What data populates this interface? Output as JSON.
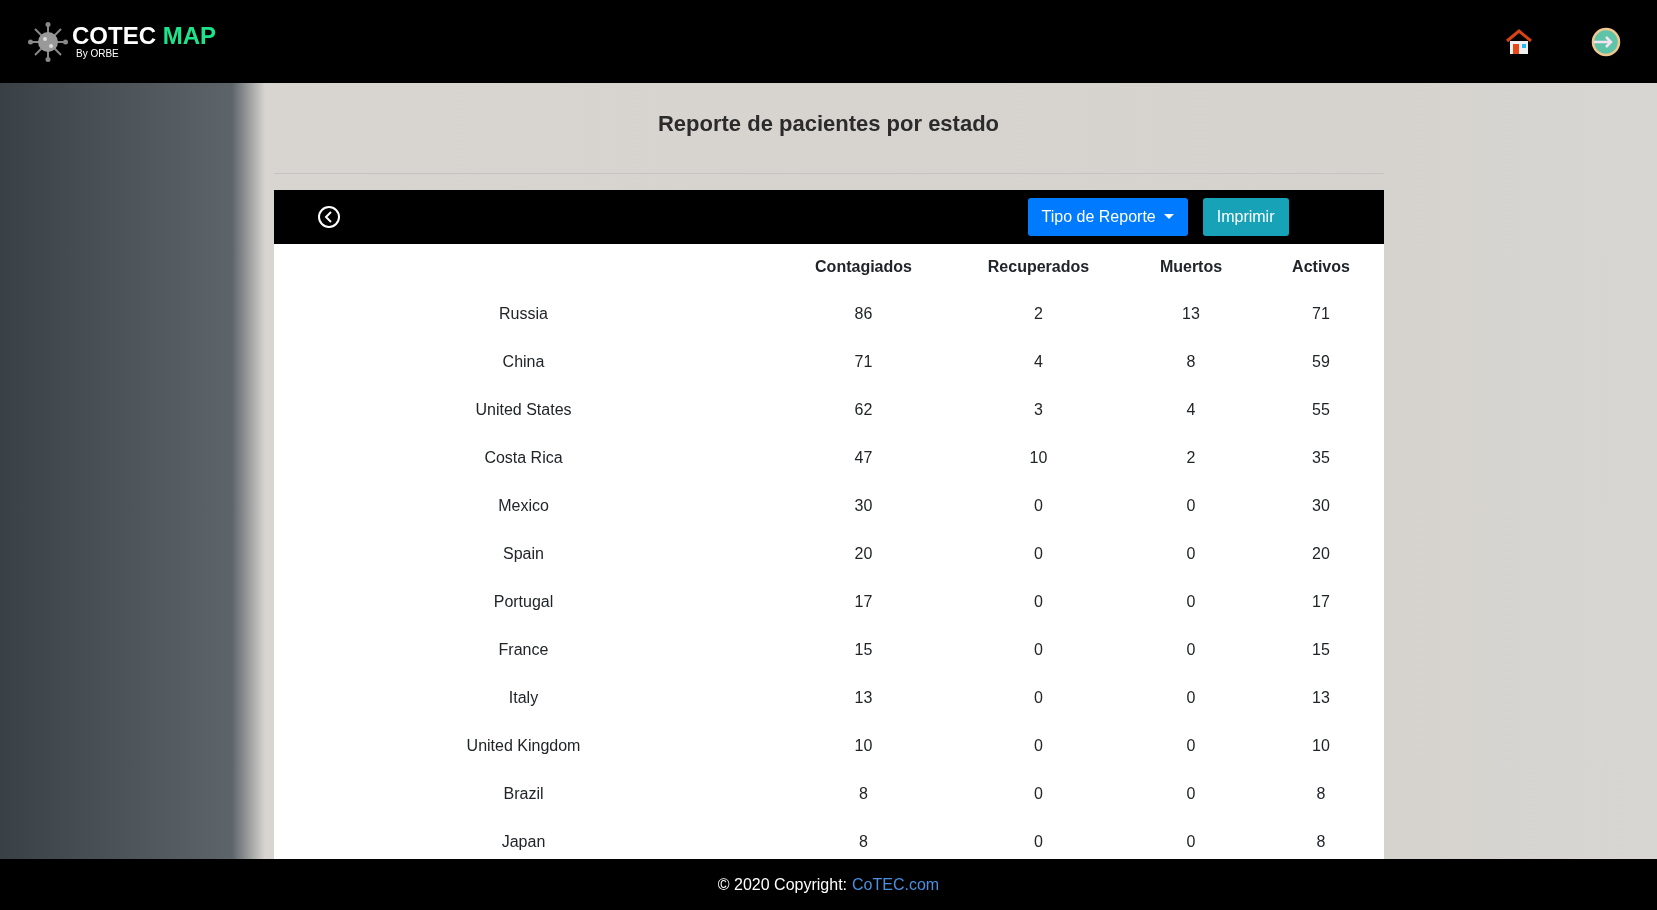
{
  "header": {
    "brand": {
      "name": "COTEC",
      "accent": "MAP",
      "byline": "By ORBE"
    }
  },
  "page": {
    "title": "Reporte de pacientes por estado"
  },
  "toolbar": {
    "report_type_button": "Tipo de Reporte",
    "print_button": "Imprimir"
  },
  "table": {
    "columns": [
      "",
      "Contagiados",
      "Recuperados",
      "Muertos",
      "Activos"
    ],
    "rows": [
      [
        "Russia",
        "86",
        "2",
        "13",
        "71"
      ],
      [
        "China",
        "71",
        "4",
        "8",
        "59"
      ],
      [
        "United States",
        "62",
        "3",
        "4",
        "55"
      ],
      [
        "Costa Rica",
        "47",
        "10",
        "2",
        "35"
      ],
      [
        "Mexico",
        "30",
        "0",
        "0",
        "30"
      ],
      [
        "Spain",
        "20",
        "0",
        "0",
        "20"
      ],
      [
        "Portugal",
        "17",
        "0",
        "0",
        "17"
      ],
      [
        "France",
        "15",
        "0",
        "0",
        "15"
      ],
      [
        "Italy",
        "13",
        "0",
        "0",
        "13"
      ],
      [
        "United Kingdom",
        "10",
        "0",
        "0",
        "10"
      ],
      [
        "Brazil",
        "8",
        "0",
        "0",
        "8"
      ],
      [
        "Japan",
        "8",
        "0",
        "0",
        "8"
      ]
    ]
  },
  "footer": {
    "text": "© 2020 Copyright:",
    "link": "CoTEC.com"
  }
}
